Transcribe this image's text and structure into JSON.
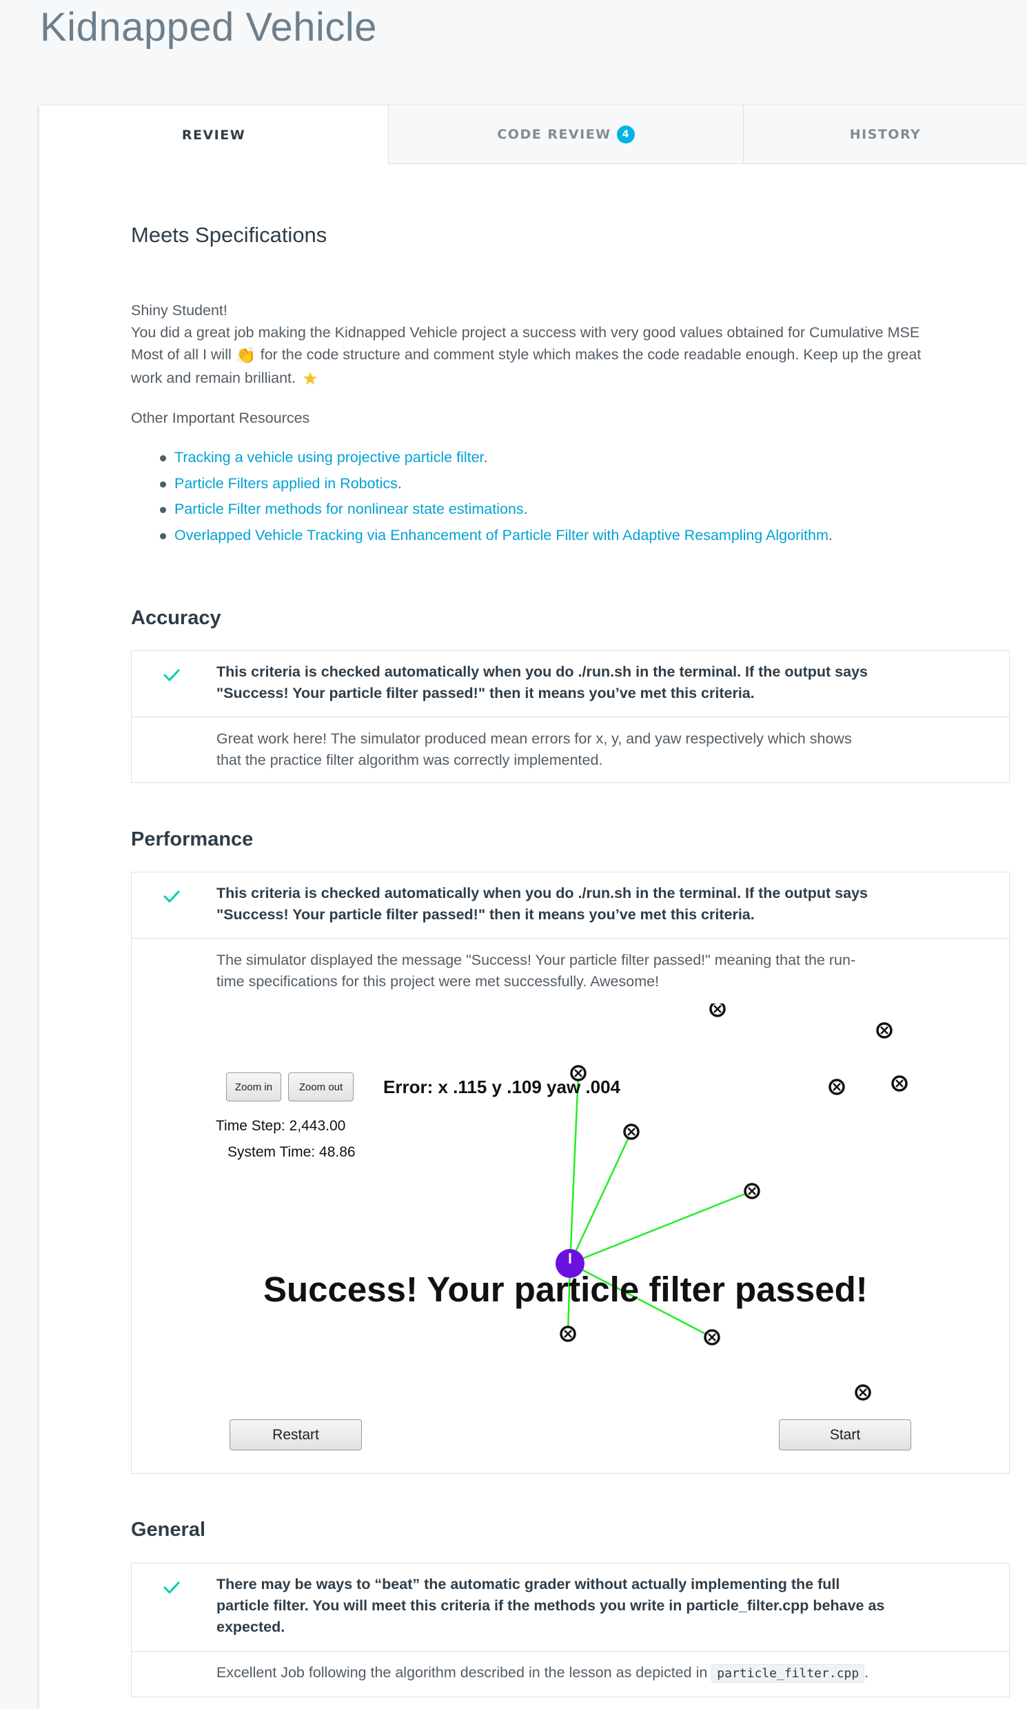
{
  "page": {
    "title": "Kidnapped Vehicle"
  },
  "tabs": [
    {
      "label": "REVIEW",
      "active": true
    },
    {
      "label": "CODE REVIEW",
      "badge": "4"
    },
    {
      "label": "HISTORY"
    }
  ],
  "summary": {
    "heading": "Meets Specifications",
    "greeting": "Shiny Student!",
    "line1": "You did a great job making the Kidnapped Vehicle project a success with very good values obtained for Cumulative MSE",
    "line2_before": "Most of all I will",
    "line2_after": "for the code structure and comment style which makes the code readable enough. Keep up the great",
    "line3": "work and remain brilliant.",
    "clap_icon": "clapping-hands-emoji",
    "star_icon": "star-emoji",
    "resources_label": "Other Important Resources",
    "resources": [
      {
        "text": "Tracking a vehicle using projective particle filter"
      },
      {
        "text": "Particle Filters applied in Robotics"
      },
      {
        "text": "Particle Filter methods for nonlinear state estimations"
      },
      {
        "text": "Overlapped Vehicle Tracking via Enhancement of Particle Filter with Adaptive Resampling Algorithm"
      }
    ]
  },
  "sections": {
    "accuracy": {
      "title": "Accuracy",
      "criteria_l1": "This criteria is checked automatically when you do ./run.sh in the terminal. If the output says",
      "criteria_l2": "\"Success! Your particle filter passed!\" then it means you’ve met this criteria.",
      "comment_l1": "Great work here! The simulator produced mean errors for x, y, and yaw respectively which shows",
      "comment_l2": "that the practice filter algorithm was correctly implemented."
    },
    "performance": {
      "title": "Performance",
      "criteria_l1": "This criteria is checked automatically when you do ./run.sh in the terminal. If the output says",
      "criteria_l2": "\"Success! Your particle filter passed!\" then it means you’ve met this criteria.",
      "comment_l1": "The simulator displayed the message \"Success! Your particle filter passed!\" meaning that the run-",
      "comment_l2": "time specifications for this project were met successfully. Awesome!"
    },
    "general": {
      "title": "General",
      "criteria_l1": "There may be ways to “beat” the automatic grader without actually implementing the full",
      "criteria_l2": "particle filter. You will meet this criteria if the methods you write in particle_filter.cpp behave as",
      "criteria_l3": "expected.",
      "comment_before": "Excellent Job following the algorithm described in the lesson as depicted in",
      "comment_code": "particle_filter.cpp",
      "comment_after": "."
    }
  },
  "simulator": {
    "zoom_in": "Zoom in",
    "zoom_out": "Zoom out",
    "error": "Error: x .115 y .109 yaw .004",
    "time_step": "Time Step: 2,443.00",
    "system_time": "System Time: 48.86",
    "success": "Success! Your particle filter passed!",
    "restart": "Restart",
    "start": "Start",
    "colors": {
      "ray": "#22ee22",
      "vehicle": "#6a11e0",
      "landmark": "#111111"
    }
  },
  "colors": {
    "accent": "#02b3e4",
    "link": "#02a2d4",
    "check": "#02ccba"
  }
}
